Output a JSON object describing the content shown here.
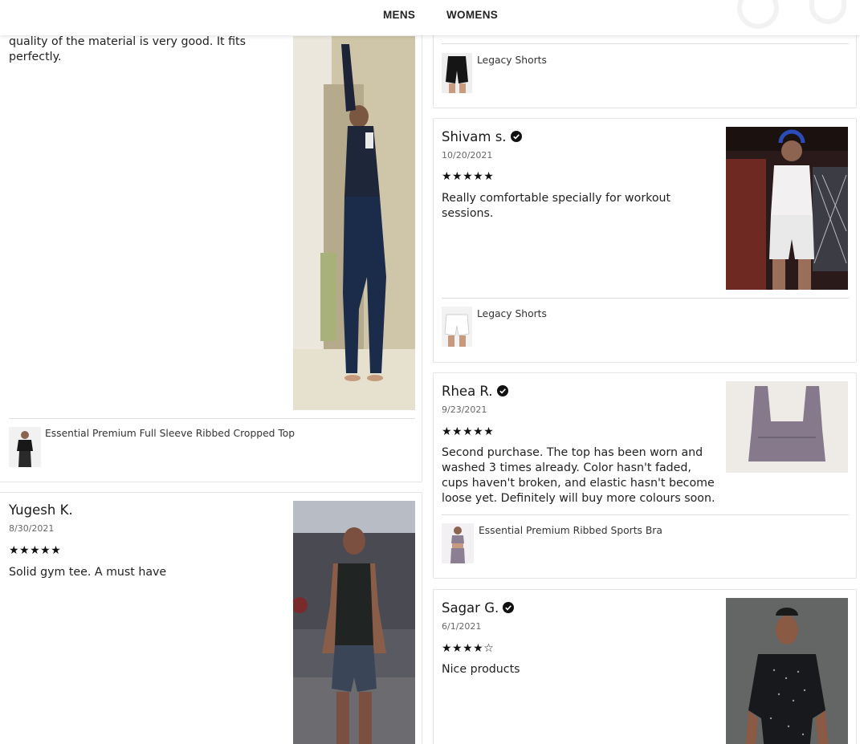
{
  "header": {
    "nav": [
      "MENS",
      "WOMENS"
    ]
  },
  "reviews": {
    "top_left": {
      "text": "quality of the material is very good. It fits perfectly.",
      "product": "Essential Premium Full Sleeve Ribbed Cropped Top"
    },
    "top_right": {
      "product": "Legacy Shorts"
    },
    "yugesh": {
      "name": "Yugesh K.",
      "date": "8/30/2021",
      "stars": "★★★★★",
      "rating": 5,
      "text": "Solid gym tee. A must have"
    },
    "shivam": {
      "name": "Shivam s.",
      "date": "10/20/2021",
      "stars": "★★★★★",
      "rating": 5,
      "text": "Really comfortable specially for workout sessions.",
      "product": "Legacy Shorts"
    },
    "rhea": {
      "name": "Rhea R.",
      "date": "9/23/2021",
      "stars": "★★★★★",
      "rating": 5,
      "text": "Second purchase. The top has been worn and washed 3 times already. Color hasn't faded, cups haven't broken, and elastic hasn't become loose yet. Definitely will buy more colours soon.",
      "product": "Essential Premium Ribbed Sports Bra"
    },
    "sagar": {
      "name": "Sagar G.",
      "date": "6/1/2021",
      "stars": "★★★★☆",
      "rating": 4,
      "text": "Nice products"
    }
  },
  "icons": {
    "verified": "verified-check-icon",
    "star": "star-icon"
  }
}
